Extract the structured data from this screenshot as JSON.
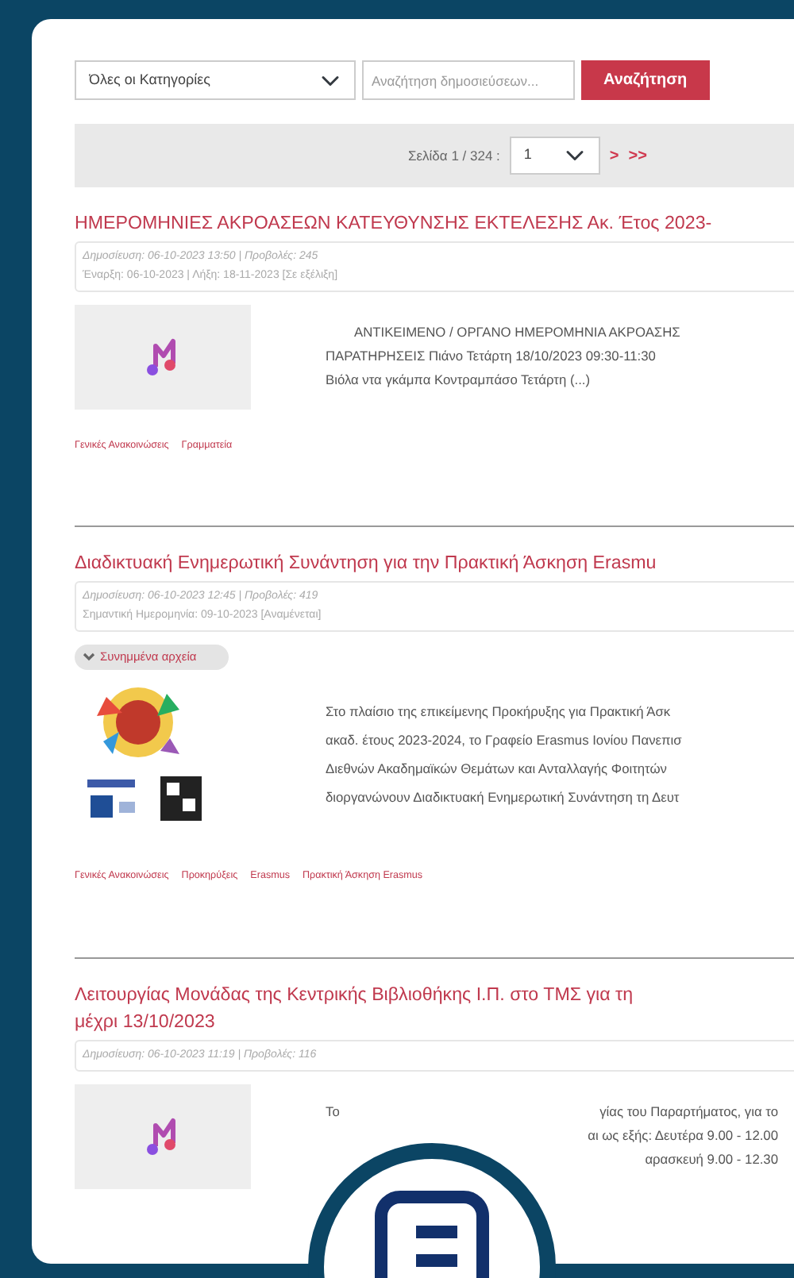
{
  "filters": {
    "category": "Όλες οι Κατηγορίες",
    "search_placeholder": "Αναζήτηση δημοσιεύσεων...",
    "search_button": "Αναζήτηση"
  },
  "pager": {
    "label": "Σελίδα 1 / 324 :",
    "page": "1",
    "links": [
      ">",
      ">>"
    ]
  },
  "posts": [
    {
      "title_lines": [
        "ΗΜΕΡΟΜΗΝΙΕΣ ΑΚΡΟΑΣΕΩΝ ΚΑΤΕΥΘΥΝΣΗΣ ΕΚΤΕΛΕΣΗΣ Ακ. Έτος 2023-"
      ],
      "meta_lines": [
        {
          "kind": "published",
          "text": "Δημοσίευση: 06-10-2023 13:50  |  Προβολές: 245"
        },
        {
          "kind": "dates",
          "text": "Έναρξη: 06-10-2023  |  Λήξη: 18-11-2023   [Σε εξέλιξη]"
        }
      ],
      "image": {
        "kind": "note"
      },
      "body_lines": [
        [
          "ΑΝΤΙΚΕΙΜΕΝΟ / ΟΡΓΑΝΟ ΗΜΕΡΟΜΗΝΙΑ ΑΚΡΟΑΣΗΣ"
        ],
        [
          "ΠΑΡΑΤΗΡΗΣΕΙΣ Πιάνο Τετάρτη 18/10/2023 09:30-11:30"
        ],
        [
          "Βιόλα ντα γκάμπα Κοντραμπάσο Τετάρτη  (...)"
        ]
      ],
      "tags": [
        "Γενικές Ανακοινώσεις",
        "Γραμματεία"
      ]
    },
    {
      "title_lines": [
        "Διαδικτυακή Ενημερωτική Συνάντηση για την Πρακτική Άσκηση Erasmu"
      ],
      "meta_lines": [
        {
          "kind": "published",
          "text": "Δημοσίευση: 06-10-2023 12:45  |  Προβολές: 419"
        },
        {
          "kind": "dates",
          "text": "Σημαντική Ημερομηνία: 09-10-2023   [Αναμένεται]"
        }
      ],
      "attachments": {
        "label": "Συνημμένα αρχεία",
        "expanded": false
      },
      "image": {
        "kind": "picture"
      },
      "body_lines": [
        [
          "Στο πλαίσιο της επικείμενης Προκήρυξης για Πρακτική Άσκ"
        ],
        [
          "ακαδ. έτους 2023-2024, το Γραφείο Erasmus Ιονίου Πανεπισ"
        ],
        [
          "Διεθνών Ακαδημαϊκών Θεμάτων και Ανταλλαγής Φοιτητών"
        ],
        [
          "διοργανώνουν Διαδικτυακή Ενημερωτική Συνάντηση τη Δευτ"
        ]
      ],
      "tags": [
        "Γενικές Ανακοινώσεις",
        "Προκηρύξεις",
        "Erasmus",
        "Πρακτική Άσκηση Erasmus"
      ]
    },
    {
      "title_lines": [
        "Λειτουργίας Μονάδας της Κεντρικής Βιβλιοθήκης Ι.Π. στο ΤΜΣ για τη",
        "μέχρι 13/10/2023"
      ],
      "meta_lines": [
        {
          "kind": "published",
          "text": "Δημοσίευση: 06-10-2023 11:19  |  Προβολές: 116"
        }
      ],
      "image": {
        "kind": "note"
      },
      "body_lines": [
        [
          "Το",
          "γίας του Παραρτήματος, για το"
        ],
        [
          "αι ως εξής: Δευτέρα 9.00 - 12.00"
        ],
        [
          "αρασκευή 9.00 - 12.30"
        ]
      ]
    }
  ]
}
